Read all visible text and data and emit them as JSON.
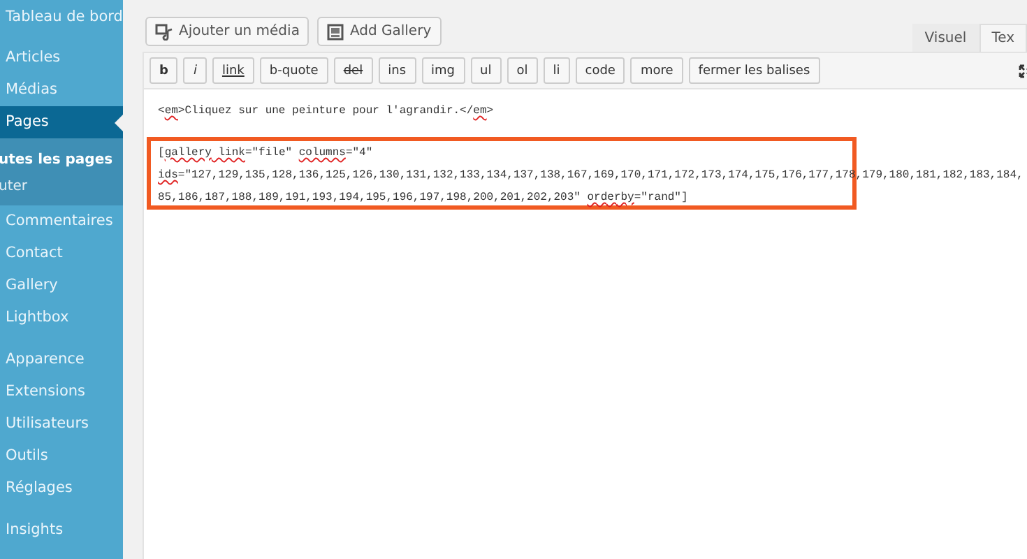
{
  "sidebar": {
    "sections": [
      [
        {
          "label": "Tableau de bord",
          "selected": false
        }
      ],
      [
        {
          "label": "Articles",
          "selected": false
        },
        {
          "label": "Médias",
          "selected": false
        },
        {
          "label": "Pages",
          "selected": true,
          "children": [
            {
              "label": "utes les pages",
              "selected": true
            },
            {
              "label": "uter",
              "selected": false
            }
          ]
        },
        {
          "label": "Commentaires",
          "selected": false
        },
        {
          "label": "Contact",
          "selected": false
        },
        {
          "label": "Gallery",
          "selected": false
        },
        {
          "label": "Lightbox",
          "selected": false
        }
      ],
      [
        {
          "label": "Apparence",
          "selected": false
        },
        {
          "label": "Extensions",
          "selected": false
        },
        {
          "label": "Utilisateurs",
          "selected": false
        },
        {
          "label": "Outils",
          "selected": false
        },
        {
          "label": "Réglages",
          "selected": false
        }
      ],
      [
        {
          "label": "Insights",
          "selected": false
        }
      ]
    ]
  },
  "editor": {
    "media_buttons": [
      {
        "label": "Ajouter un média",
        "kind": "media"
      },
      {
        "label": "Add Gallery",
        "kind": "gallery"
      }
    ],
    "tabs": [
      {
        "label": "Visuel",
        "selected": false
      },
      {
        "label": "Tex",
        "selected": true
      }
    ],
    "quicktags": [
      {
        "label": "b",
        "kind": "bold"
      },
      {
        "label": "i",
        "kind": "italic"
      },
      {
        "label": "link",
        "kind": "underline"
      },
      {
        "label": "b-quote",
        "kind": "plain"
      },
      {
        "label": "del",
        "kind": "strike"
      },
      {
        "label": "ins",
        "kind": "plain"
      },
      {
        "label": "img",
        "kind": "plain"
      },
      {
        "label": "ul",
        "kind": "plain"
      },
      {
        "label": "ol",
        "kind": "plain"
      },
      {
        "label": "li",
        "kind": "plain"
      },
      {
        "label": "code",
        "kind": "plain"
      },
      {
        "label": "more",
        "kind": "plain"
      },
      {
        "label": "fermer les balises",
        "kind": "plain"
      }
    ],
    "blocks": [
      {
        "kind": "plain",
        "lines": [
          [
            {
              "text": "<",
              "misspelled": false
            },
            {
              "text": "em",
              "misspelled": true
            },
            {
              "text": ">Cliquez sur une peinture pour l'agrandir.</",
              "misspelled": false
            },
            {
              "text": "em",
              "misspelled": true
            },
            {
              "text": ">",
              "misspelled": false
            }
          ]
        ]
      },
      {
        "kind": "framed",
        "lines": [
          [
            {
              "text": "[",
              "misspelled": false
            },
            {
              "text": "gallery",
              "misspelled": true
            },
            {
              "text": " link",
              "misspelled": true
            },
            {
              "text": "=\"file\" ",
              "misspelled": false
            },
            {
              "text": "columns",
              "misspelled": true
            },
            {
              "text": "=\"4\"",
              "misspelled": false
            }
          ],
          [
            {
              "text": "ids",
              "misspelled": true
            },
            {
              "text": "=\"127,129,135,128,136,125,126,130,131,132,133,134,137,138,167,169,170,171,172,173,174,175,176,177,178,179,180,181,182,183,184,",
              "misspelled": false
            }
          ],
          [
            {
              "text": "85,186,187,188,189,191,193,194,195,196,197,198,200,201,202,203\" ",
              "misspelled": false
            },
            {
              "text": "orderby",
              "misspelled": true
            },
            {
              "text": "=\"rand\"]",
              "misspelled": false
            }
          ]
        ]
      }
    ]
  }
}
